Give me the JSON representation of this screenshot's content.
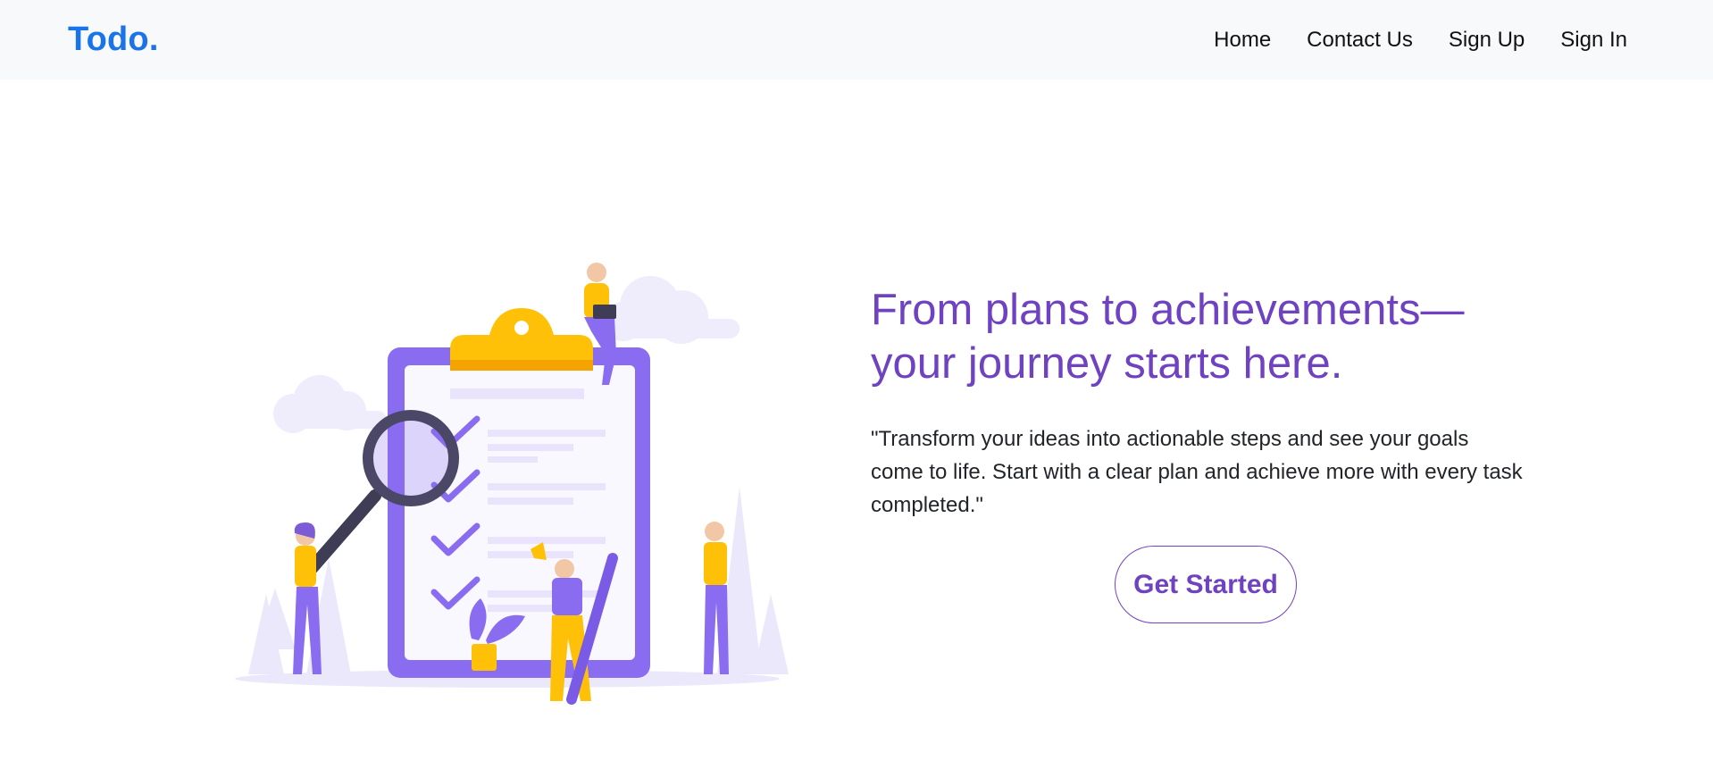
{
  "navbar": {
    "brand": "Todo.",
    "links": [
      {
        "label": "Home"
      },
      {
        "label": "Contact Us"
      },
      {
        "label": "Sign Up"
      },
      {
        "label": "Sign In"
      }
    ]
  },
  "hero": {
    "headline_line1": "From plans to achievements—",
    "headline_line2": "your journey starts here.",
    "quote": "\"Transform your ideas into actionable steps and see your goals come to life. Start with a clear plan and achieve more with every task completed.\"",
    "cta_label": "Get Started",
    "illustration_icon": "todo-checklist-illustration"
  },
  "colors": {
    "brand_blue": "#1a73e8",
    "accent_purple": "#6f42c1",
    "illustration_purple": "#8a6cf0",
    "illustration_yellow": "#ffc107",
    "navbar_bg": "#f8f9fa"
  }
}
